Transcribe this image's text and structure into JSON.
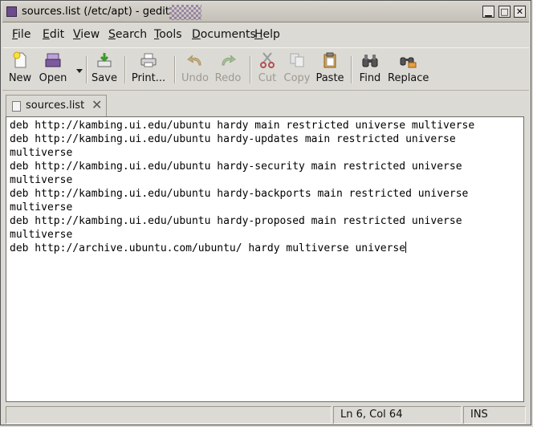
{
  "window": {
    "title": "sources.list (/etc/apt) - gedit",
    "controls": {
      "minimize": "▁",
      "maximize": "□",
      "close": "✕"
    }
  },
  "menubar": [
    {
      "label": "File",
      "mnemonic": "F",
      "rest": "ile"
    },
    {
      "label": "Edit",
      "mnemonic": "E",
      "rest": "dit"
    },
    {
      "label": "View",
      "mnemonic": "V",
      "rest": "iew"
    },
    {
      "label": "Search",
      "mnemonic": "S",
      "rest": "earch"
    },
    {
      "label": "Tools",
      "mnemonic": "T",
      "rest": "ools"
    },
    {
      "label": "Documents",
      "mnemonic": "D",
      "rest": "ocuments"
    },
    {
      "label": "Help",
      "mnemonic": "H",
      "rest": "elp"
    }
  ],
  "toolbar": {
    "new": "New",
    "open": "Open",
    "save": "Save",
    "print": "Print...",
    "undo": "Undo",
    "redo": "Redo",
    "cut": "Cut",
    "copy": "Copy",
    "paste": "Paste",
    "find": "Find",
    "replace": "Replace"
  },
  "tab": {
    "label": "sources.list",
    "close": "✕"
  },
  "editor": {
    "lines": [
      "deb http://kambing.ui.edu/ubuntu hardy main restricted universe multiverse",
      "deb http://kambing.ui.edu/ubuntu hardy-updates main restricted universe",
      "multiverse",
      "deb http://kambing.ui.edu/ubuntu hardy-security main restricted universe",
      "multiverse",
      "deb http://kambing.ui.edu/ubuntu hardy-backports main restricted universe",
      "multiverse",
      "deb http://kambing.ui.edu/ubuntu hardy-proposed main restricted universe",
      "multiverse",
      "deb http://archive.ubuntu.com/ubuntu/ hardy multiverse universe"
    ]
  },
  "statusbar": {
    "position": "Ln 6, Col 64",
    "mode": "INS"
  },
  "colors": {
    "accent": "#6d4c8c",
    "window_bg": "#dcdad5",
    "editor_bg": "#ffffff"
  }
}
